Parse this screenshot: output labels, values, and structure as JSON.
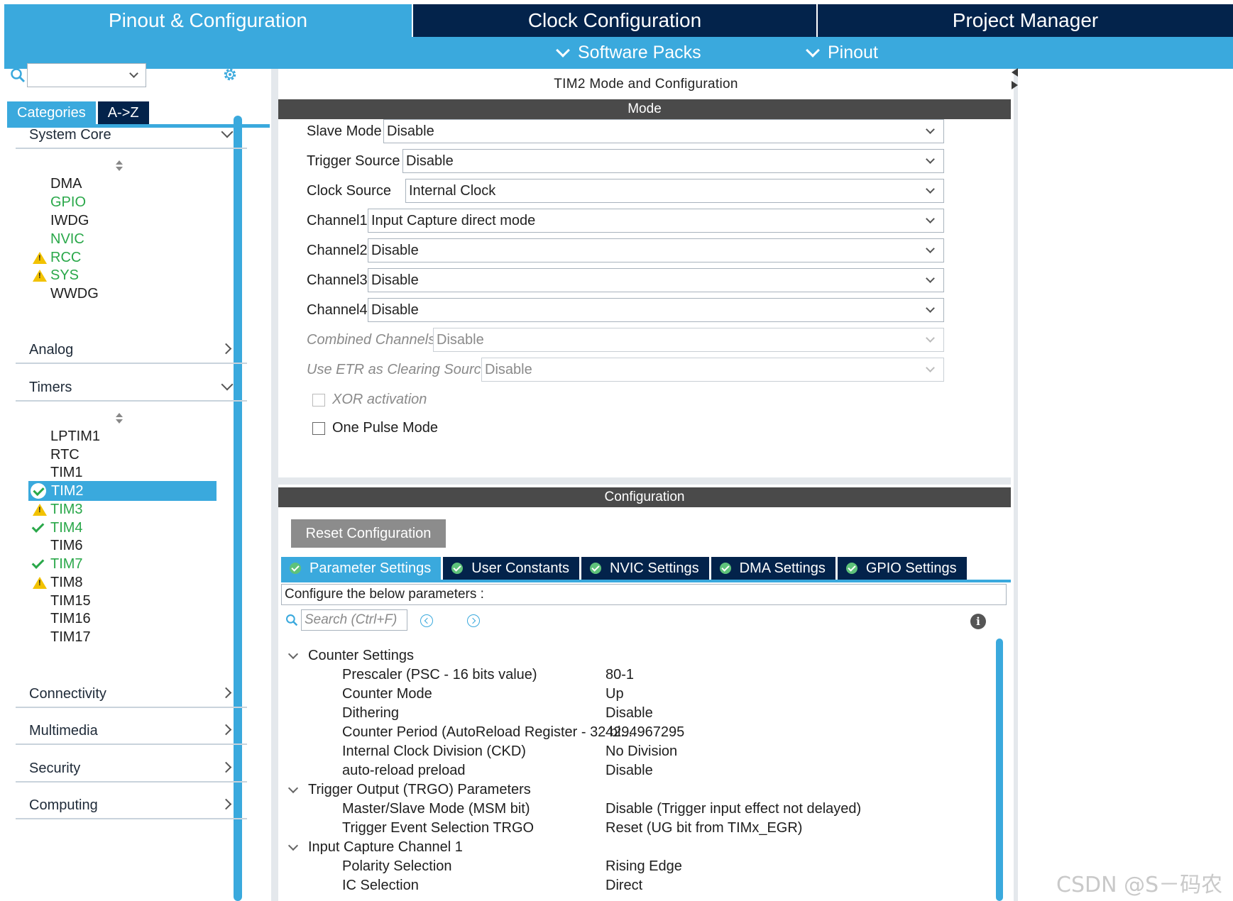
{
  "top_tabs": [
    {
      "label": "Pinout & Configuration",
      "active": true
    },
    {
      "label": "Clock Configuration",
      "active": false
    },
    {
      "label": "Project Manager",
      "active": false
    }
  ],
  "sub_menu": {
    "software_packs": "Software Packs",
    "pinout": "Pinout"
  },
  "sidebar": {
    "search_value": "",
    "category_tabs": [
      "Categories",
      "A->Z"
    ],
    "groups": {
      "system_core": "System Core",
      "analog": "Analog",
      "timers": "Timers",
      "connectivity": "Connectivity",
      "multimedia": "Multimedia",
      "security": "Security",
      "computing": "Computing"
    },
    "system_core_items": [
      {
        "label": "DMA",
        "status": "none"
      },
      {
        "label": "GPIO",
        "status": "green"
      },
      {
        "label": "IWDG",
        "status": "none"
      },
      {
        "label": "NVIC",
        "status": "green"
      },
      {
        "label": "RCC",
        "status": "warning"
      },
      {
        "label": "SYS",
        "status": "warning"
      },
      {
        "label": "WWDG",
        "status": "none"
      }
    ],
    "timer_items": [
      {
        "label": "LPTIM1",
        "status": "none"
      },
      {
        "label": "RTC",
        "status": "none"
      },
      {
        "label": "TIM1",
        "status": "none"
      },
      {
        "label": "TIM2",
        "status": "selected"
      },
      {
        "label": "TIM3",
        "status": "warning"
      },
      {
        "label": "TIM4",
        "status": "ok"
      },
      {
        "label": "TIM6",
        "status": "none"
      },
      {
        "label": "TIM7",
        "status": "ok"
      },
      {
        "label": "TIM8",
        "status": "warning"
      },
      {
        "label": "TIM15",
        "status": "none"
      },
      {
        "label": "TIM16",
        "status": "none"
      },
      {
        "label": "TIM17",
        "status": "none"
      }
    ]
  },
  "main": {
    "title": "TIM2 Mode and Configuration",
    "mode_header": "Mode",
    "mode_fields": [
      {
        "label": "Slave Mode",
        "value": "Disable",
        "disabled": false
      },
      {
        "label": "Trigger Source",
        "value": "Disable",
        "disabled": false
      },
      {
        "label": "Clock Source",
        "value": "Internal Clock",
        "disabled": false
      },
      {
        "label": "Channel1",
        "value": "Input Capture direct mode",
        "disabled": false
      },
      {
        "label": "Channel2",
        "value": "Disable",
        "disabled": false
      },
      {
        "label": "Channel3",
        "value": "Disable",
        "disabled": false
      },
      {
        "label": "Channel4",
        "value": "Disable",
        "disabled": false
      },
      {
        "label": "Combined Channels",
        "value": "Disable",
        "disabled": true
      },
      {
        "label": "Use ETR as Clearing Source",
        "value": "Disable",
        "disabled": true
      }
    ],
    "xor_label": "XOR activation",
    "one_pulse_label": "One Pulse Mode",
    "config_header": "Configuration",
    "reset_button": "Reset Configuration",
    "param_tabs": [
      "Parameter Settings",
      "User Constants",
      "NVIC Settings",
      "DMA Settings",
      "GPIO Settings"
    ],
    "param_header": "Configure the below parameters :",
    "search_placeholder": "Search (Ctrl+F)",
    "info_icon": "i",
    "tree": {
      "counter_settings": "Counter Settings",
      "counter_rows": [
        {
          "name": "Prescaler (PSC - 16 bits value)",
          "value": "80-1"
        },
        {
          "name": "Counter Mode",
          "value": "Up"
        },
        {
          "name": "Dithering",
          "value": "Disable"
        },
        {
          "name": "Counter Period (AutoReload Register - 32 bi...",
          "value": "4294967295"
        },
        {
          "name": "Internal Clock Division (CKD)",
          "value": "No Division"
        },
        {
          "name": "auto-reload preload",
          "value": "Disable"
        }
      ],
      "trgo": "Trigger Output (TRGO) Parameters",
      "trgo_rows": [
        {
          "name": "Master/Slave Mode (MSM bit)",
          "value": "Disable (Trigger input effect not delayed)"
        },
        {
          "name": "Trigger Event Selection TRGO",
          "value": "Reset (UG bit from TIMx_EGR)"
        }
      ],
      "input_capture": "Input Capture Channel 1",
      "ic_rows": [
        {
          "name": "Polarity Selection",
          "value": "Rising Edge"
        },
        {
          "name": "IC Selection",
          "value": "Direct"
        }
      ]
    }
  },
  "watermark": "CSDN @S－码农",
  "colors": {
    "accent": "#3aa9dd",
    "dark_navy": "#03234b",
    "section_bar": "#4a4a4a",
    "ok_green": "#2aa84a",
    "warning": "#f2c200"
  }
}
